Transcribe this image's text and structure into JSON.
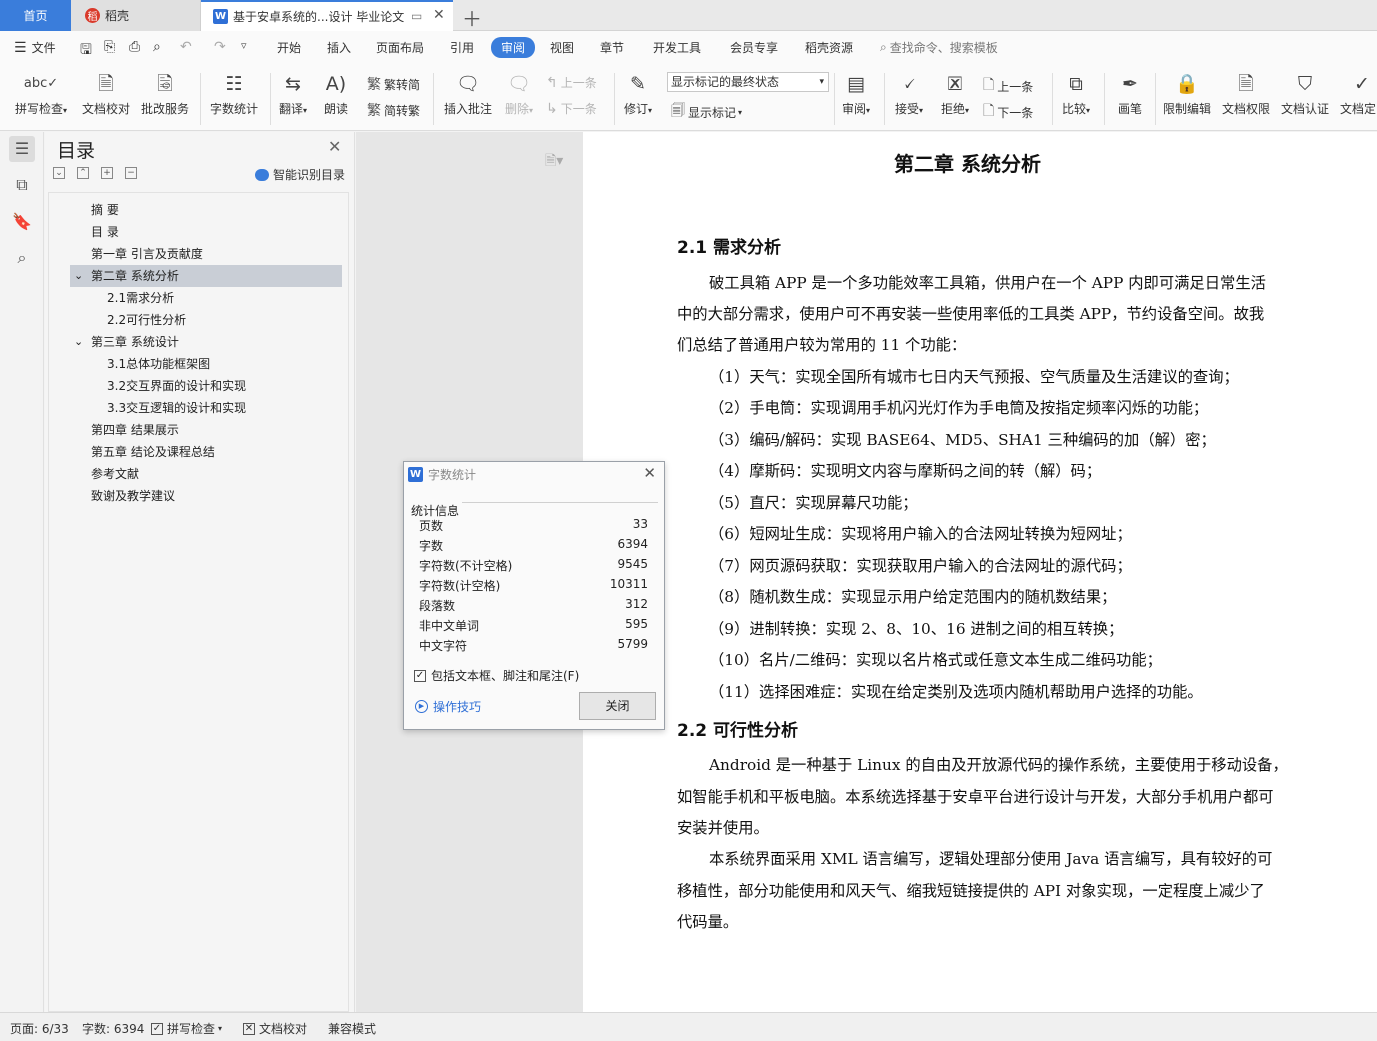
{
  "tabs": {
    "home": "首页",
    "daoke": "稻壳",
    "doc": "基于安卓系统的...设计 毕业论文",
    "add_icon": "plus-icon"
  },
  "menubar": {
    "file": "文件",
    "items": [
      "开始",
      "插入",
      "页面布局",
      "引用",
      "审阅",
      "视图",
      "章节",
      "开发工具",
      "会员专享",
      "稻壳资源"
    ],
    "search_placeholder": "查找命令、搜索模板"
  },
  "ribbon": {
    "spell": "拼写检查",
    "proofread": "文档校对",
    "annotate": "批改服务",
    "wordcount": "字数统计",
    "translate": "翻译",
    "read": "朗读",
    "trad": "繁转简",
    "simp": "简转繁",
    "insert_comment": "插入批注",
    "delete": "删除",
    "prev_comment": "上一条",
    "next_comment": "下一条",
    "track": "修订",
    "display_select": "显示标记的最终状态",
    "show_markup": "显示标记",
    "review": "审阅",
    "accept": "接受",
    "reject": "拒绝",
    "prev_change": "上一条",
    "next_change": "下一条",
    "compare": "比较",
    "brush": "画笔",
    "restrict": "限制编辑",
    "permission": "文档权限",
    "cert": "文档认证",
    "docfix": "文档定"
  },
  "toc": {
    "title": "目录",
    "smart": "智能识别目录",
    "items": [
      {
        "label": "摘  要",
        "level": 1
      },
      {
        "label": "目  录",
        "level": 1
      },
      {
        "label": "第一章  引言及贡献度",
        "level": 1
      },
      {
        "label": "第二章  系统分析",
        "level": 1,
        "expanded": true,
        "selected": true
      },
      {
        "label": "2.1需求分析",
        "level": 2
      },
      {
        "label": "2.2可行性分析",
        "level": 2
      },
      {
        "label": "第三章  系统设计",
        "level": 1,
        "expanded": true
      },
      {
        "label": "3.1总体功能框架图",
        "level": 2
      },
      {
        "label": "3.2交互界面的设计和实现",
        "level": 2
      },
      {
        "label": "3.3交互逻辑的设计和实现",
        "level": 2
      },
      {
        "label": "第四章  结果展示",
        "level": 1
      },
      {
        "label": "第五章  结论及课程总结",
        "level": 1
      },
      {
        "label": "参考文献",
        "level": 1
      },
      {
        "label": "致谢及教学建议",
        "level": 1
      }
    ]
  },
  "doc": {
    "chapter": "第二章    系统分析",
    "s21": "2.1  需求分析",
    "p1a": "破工具箱 APP 是一个多功能效率工具箱，供用户在一个 APP 内即可满足日常生活",
    "p1b": "中的大部分需求，使用户可不再安装一些使用率低的工具类 APP，节约设备空间。故我",
    "p1c": "们总结了普通用户较为常用的 11 个功能：",
    "f1": "（1）天气：实现全国所有城市七日内天气预报、空气质量及生活建议的查询；",
    "f2": "（2）手电筒：实现调用手机闪光灯作为手电筒及按指定频率闪烁的功能；",
    "f3": "（3）编码/解码：实现 BASE64、MD5、SHA1 三种编码的加（解）密；",
    "f4": "（4）摩斯码：实现明文内容与摩斯码之间的转（解）码；",
    "f5": "（5）直尺：实现屏幕尺功能；",
    "f6": "（6）短网址生成：实现将用户输入的合法网址转换为短网址；",
    "f7": "（7）网页源码获取：实现获取用户输入的合法网址的源代码；",
    "f8": "（8）随机数生成：实现显示用户给定范围内的随机数结果；",
    "f9": "（9）进制转换：实现 2、8、10、16 进制之间的相互转换；",
    "f10": "（10）名片/二维码：实现以名片格式或任意文本生成二维码功能；",
    "f11": "（11）选择困难症：实现在给定类别及选项内随机帮助用户选择的功能。",
    "s22": "2.2  可行性分析",
    "p2a": "Android 是一种基于 Linux 的自由及开放源代码的操作系统，主要使用于移动设备，",
    "p2b": "如智能手机和平板电脑。本系统选择基于安卓平台进行设计与开发，大部分手机用户都可",
    "p2c": "安装并使用。",
    "p3a": "本系统界面采用 XML 语言编写，逻辑处理部分使用 Java 语言编写，具有较好的可",
    "p3b": "移植性，部分功能使用和风天气、缩我短链接提供的 API 对象实现，一定程度上减少了",
    "p3c": "代码量。"
  },
  "dialog": {
    "title": "字数统计",
    "group": "统计信息",
    "stats": [
      {
        "label": "页数",
        "value": "33"
      },
      {
        "label": "字数",
        "value": "6394"
      },
      {
        "label": "字符数(不计空格)",
        "value": "9545"
      },
      {
        "label": "字符数(计空格)",
        "value": "10311"
      },
      {
        "label": "段落数",
        "value": "312"
      },
      {
        "label": "非中文单词",
        "value": "595"
      },
      {
        "label": "中文字符",
        "value": "5799"
      }
    ],
    "include": "包括文本框、脚注和尾注(F)",
    "include_checked": true,
    "tips": "操作技巧",
    "close": "关闭"
  },
  "status": {
    "page": "页面: 6/33",
    "words": "字数: 6394",
    "spell": "拼写检查",
    "proof": "文档校对",
    "compat": "兼容模式"
  },
  "colors": {
    "accent": "#3a7ddb",
    "selected_row": "#c9ced6"
  }
}
